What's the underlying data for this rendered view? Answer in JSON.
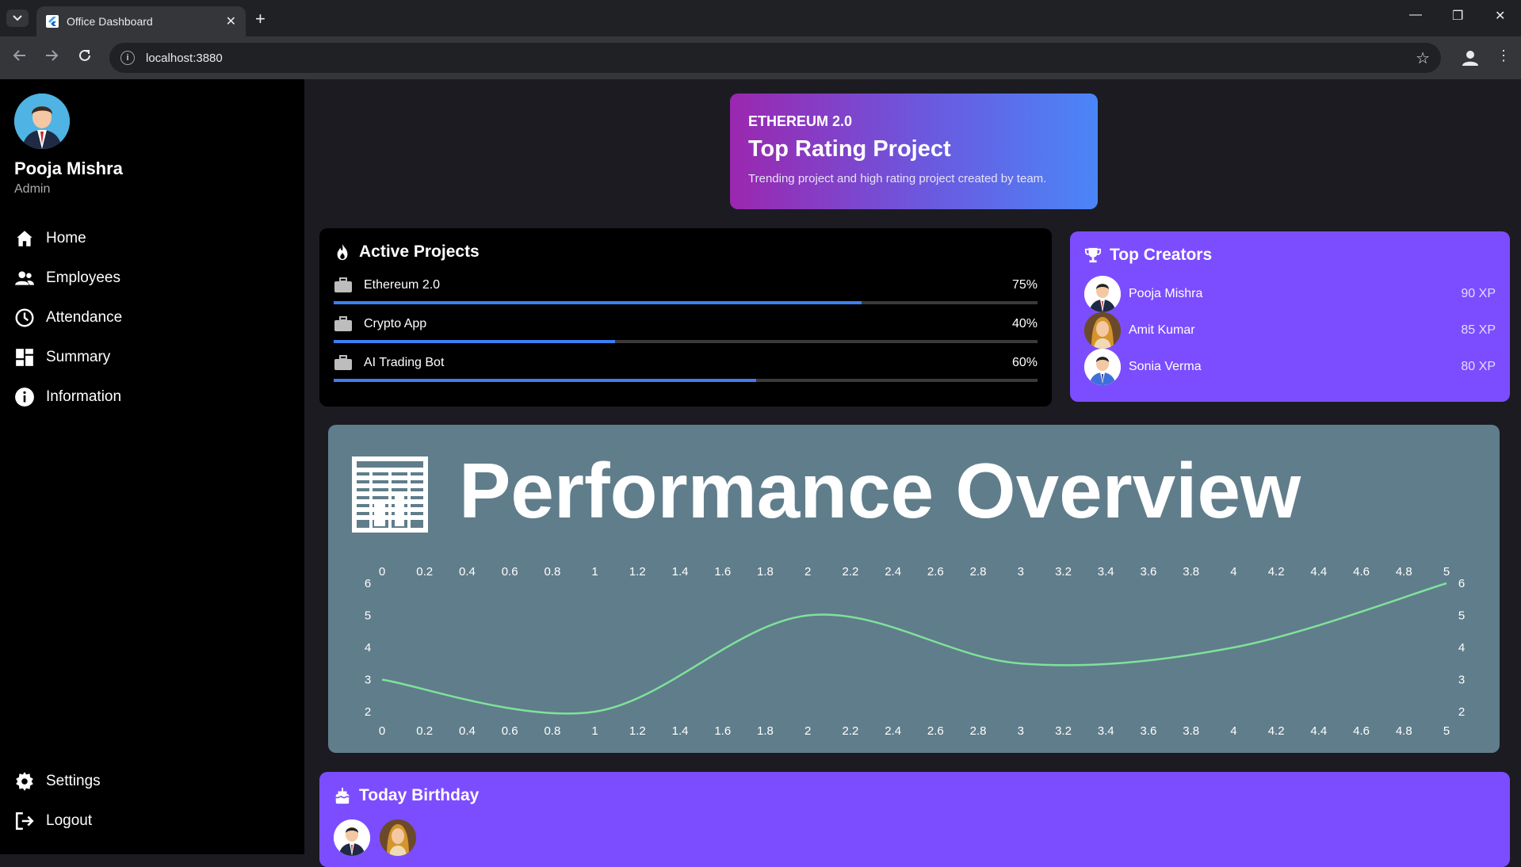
{
  "browser": {
    "tab_title": "Office Dashboard",
    "url": "localhost:3880"
  },
  "user": {
    "name": "Pooja Mishra",
    "role": "Admin"
  },
  "nav": {
    "items": [
      {
        "label": "Home",
        "icon": "home-icon"
      },
      {
        "label": "Employees",
        "icon": "people-icon"
      },
      {
        "label": "Attendance",
        "icon": "clock-icon"
      },
      {
        "label": "Summary",
        "icon": "dashboard-icon"
      },
      {
        "label": "Information",
        "icon": "info-icon"
      }
    ],
    "bottom": [
      {
        "label": "Settings",
        "icon": "gear-icon"
      },
      {
        "label": "Logout",
        "icon": "logout-icon"
      }
    ]
  },
  "hero": {
    "kicker": "ETHEREUM 2.0",
    "title": "Top Rating Project",
    "description": "Trending project and high rating project created by team."
  },
  "active_projects": {
    "title": "Active Projects",
    "items": [
      {
        "name": "Ethereum 2.0",
        "percent_label": "75%",
        "progress": 0.75
      },
      {
        "name": "Crypto App",
        "percent_label": "40%",
        "progress": 0.4
      },
      {
        "name": "AI Trading Bot",
        "percent_label": "60%",
        "progress": 0.6
      }
    ]
  },
  "top_creators": {
    "title": "Top Creators",
    "items": [
      {
        "name": "Pooja Mishra",
        "xp": "90 XP"
      },
      {
        "name": "Amit Kumar",
        "xp": "85 XP"
      },
      {
        "name": "Sonia Verma",
        "xp": "80 XP"
      }
    ]
  },
  "performance": {
    "title": "Performance Overview"
  },
  "chart_data": {
    "type": "line",
    "title": "Performance Overview",
    "x": [
      0,
      1,
      2,
      3,
      4,
      5
    ],
    "series": [
      {
        "values": [
          3,
          2,
          5,
          3.5,
          4,
          6
        ],
        "color": "#7ee29a"
      }
    ],
    "xlim": [
      0,
      5
    ],
    "ylim": [
      2,
      6
    ],
    "x_ticks": [
      "0",
      "0.2",
      "0.4",
      "0.6",
      "0.8",
      "1",
      "1.2",
      "1.4",
      "1.6",
      "1.8",
      "2",
      "2.2",
      "2.4",
      "2.6",
      "2.8",
      "3",
      "3.2",
      "3.4",
      "3.6",
      "3.8",
      "4",
      "4.2",
      "4.4",
      "4.6",
      "4.8",
      "5"
    ],
    "y_ticks": [
      "6",
      "5",
      "4",
      "3",
      "2"
    ],
    "grid": false
  },
  "birthday": {
    "title": "Today Birthday"
  },
  "colors": {
    "sidebar": "#000000",
    "main_bg": "#1c1b22",
    "accent_purple": "#7c4dff",
    "progress_blue": "#3b7ff2",
    "chart_card": "#607d8b",
    "line": "#7ee29a"
  }
}
